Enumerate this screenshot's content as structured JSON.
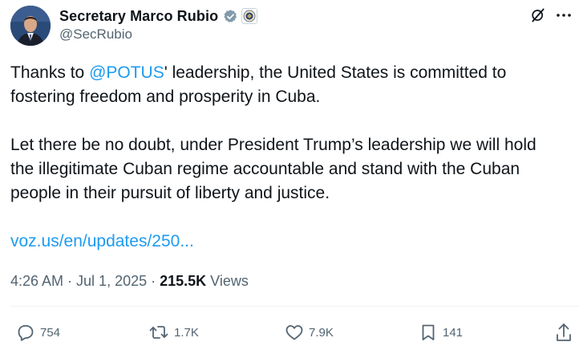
{
  "author": {
    "display_name": "Secretary Marco Rubio",
    "handle": "@SecRubio",
    "verified_badge_color": "#829aab"
  },
  "tweet": {
    "para1_before": "Thanks to ",
    "mention": "@POTUS",
    "para1_after": "' leadership, the United States is committed to fostering freedom and prosperity in Cuba.",
    "para2": "Let there be no doubt, under President Trump’s leadership we will hold the illegitimate Cuban regime accountable and stand with the Cuban people in their pursuit of liberty and justice.",
    "link": "voz.us/en/updates/250..."
  },
  "meta": {
    "time": "4:26 AM",
    "sep1": " · ",
    "date": "Jul 1, 2025",
    "sep2": " · ",
    "views_count": "215.5K",
    "views_label": " Views"
  },
  "actions": {
    "replies": "754",
    "reposts": "1.7K",
    "likes": "7.9K",
    "bookmarks": "141"
  },
  "icons": {
    "reply": "reply-icon",
    "repost": "repost-icon",
    "like": "heart-icon",
    "bookmark": "bookmark-icon",
    "share": "share-icon",
    "grok": "grok-icon",
    "more": "more-icon",
    "verified": "verified-badge-icon",
    "affiliate": "state-department-seal-icon"
  },
  "colors": {
    "link": "#1d9bf0",
    "secondary_text": "#536471",
    "primary_text": "#0f1419"
  }
}
